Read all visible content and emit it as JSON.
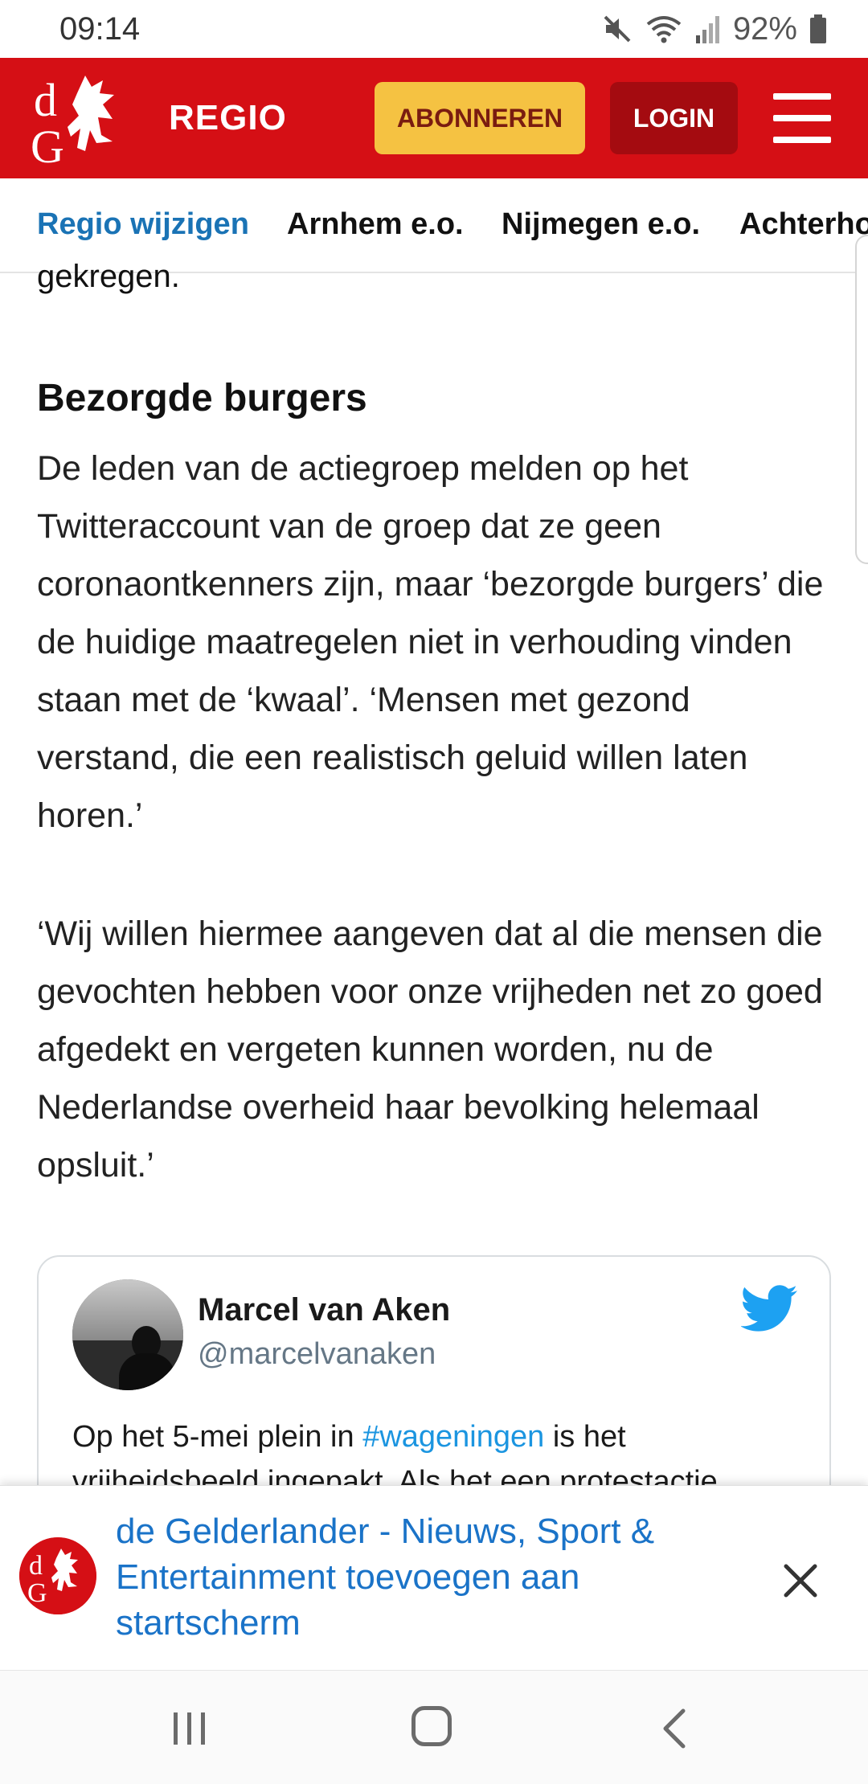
{
  "status_bar": {
    "time": "09:14",
    "battery": "92%",
    "icons": [
      "mute-icon",
      "wifi-icon",
      "signal-icon",
      "battery-icon"
    ]
  },
  "header": {
    "logo_text": "dG",
    "title": "REGIO",
    "subscribe_label": "ABONNEREN",
    "login_label": "LOGIN",
    "brand_color": "#d50f15",
    "subscribe_color": "#f5c242"
  },
  "region_nav": {
    "items": [
      {
        "label": "Regio wijzigen",
        "active": true
      },
      {
        "label": "Arnhem e.o.",
        "active": false
      },
      {
        "label": "Nijmegen e.o.",
        "active": false
      },
      {
        "label": "Achterhoek",
        "active": false
      }
    ]
  },
  "article": {
    "partial_top_line": "gekregen.",
    "subheading": "Bezorgde burgers",
    "paragraph1": "De leden van de actiegroep melden op het Twitteraccount van de groep dat ze geen coronaontkenners zijn, maar ‘bezorgde burgers’ die de huidige maatregelen niet in verhouding vinden staan met de ‘kwaal’. ‘Mensen met gezond verstand, die een realistisch geluid willen laten horen.’",
    "paragraph2": "‘Wij willen hiermee aangeven dat al die mensen die gevochten hebben voor onze vrijheden net zo goed afgedekt en vergeten kunnen worden, nu de Nederlandse overheid haar bevolking helemaal opsluit.’"
  },
  "tweet": {
    "name": "Marcel van Aken",
    "handle": "@marcelvanaken",
    "text_before": "Op het 5-mei plein in ",
    "hashtag": "#wageningen",
    "text_after": " is het vrijheidsbeeld ingepakt. Als het een protestactie"
  },
  "add_to_home": {
    "text": "de Gelderlander - Nieuws, Sport & Entertainment toevoegen aan startscherm"
  }
}
